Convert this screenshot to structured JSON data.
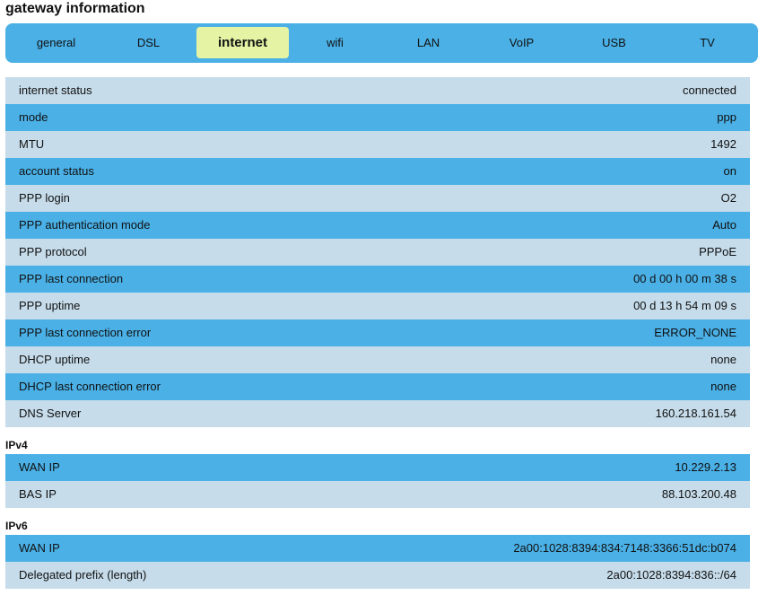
{
  "page_title": "gateway information",
  "tabs": [
    {
      "label": "general",
      "active": false
    },
    {
      "label": "DSL",
      "active": false
    },
    {
      "label": "internet",
      "active": true
    },
    {
      "label": "wifi",
      "active": false
    },
    {
      "label": "LAN",
      "active": false
    },
    {
      "label": "VoIP",
      "active": false
    },
    {
      "label": "USB",
      "active": false
    },
    {
      "label": "TV",
      "active": false
    }
  ],
  "internet_rows": [
    {
      "label": "internet status",
      "value": "connected"
    },
    {
      "label": "mode",
      "value": "ppp"
    },
    {
      "label": "MTU",
      "value": "1492"
    },
    {
      "label": "account status",
      "value": "on"
    },
    {
      "label": "PPP login",
      "value": "O2"
    },
    {
      "label": "PPP authentication mode",
      "value": "Auto"
    },
    {
      "label": "PPP protocol",
      "value": "PPPoE"
    },
    {
      "label": "PPP last connection",
      "value": "00 d 00 h 00 m 38 s"
    },
    {
      "label": "PPP uptime",
      "value": "00 d 13 h 54 m 09 s"
    },
    {
      "label": "PPP last connection error",
      "value": "ERROR_NONE"
    },
    {
      "label": "DHCP uptime",
      "value": "none"
    },
    {
      "label": "DHCP last connection error",
      "value": "none"
    },
    {
      "label": "DNS Server",
      "value": "160.218.161.54"
    }
  ],
  "ipv4": {
    "heading": "IPv4",
    "rows": [
      {
        "label": "WAN IP",
        "value": "10.229.2.13"
      },
      {
        "label": "BAS IP",
        "value": "88.103.200.48"
      }
    ]
  },
  "ipv6": {
    "heading": "IPv6",
    "rows": [
      {
        "label": "WAN IP",
        "value": "2a00:1028:8394:834:7148:3366:51dc:b074"
      },
      {
        "label": "Delegated prefix (length)",
        "value": "2a00:1028:8394:836::/64"
      }
    ]
  },
  "colors": {
    "accent_blue": "#4ab0e6",
    "row_light": "#c6dcea",
    "tab_active": "#e4f3a4"
  }
}
